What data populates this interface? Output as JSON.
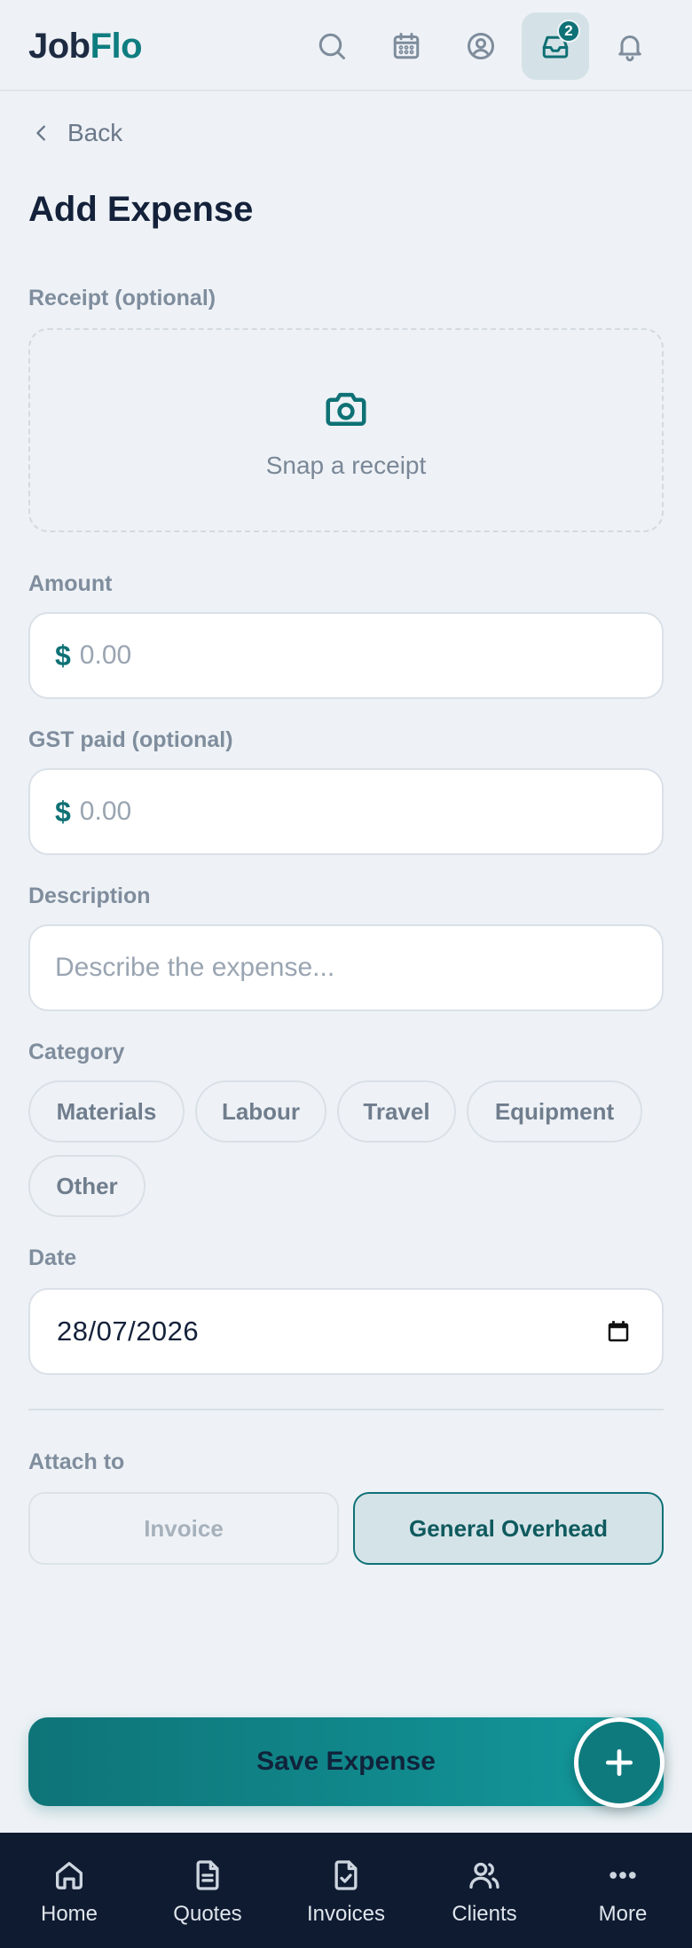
{
  "header": {
    "logo_part1": "Job",
    "logo_part2": "Flo",
    "inbox_badge": "2",
    "icons": [
      "search-icon",
      "calendar-icon",
      "user-circle-icon",
      "inbox-icon",
      "bell-icon"
    ]
  },
  "nav": {
    "back_label": "Back"
  },
  "page": {
    "title": "Add Expense"
  },
  "receipt": {
    "label": "Receipt (optional)",
    "prompt": "Snap a receipt"
  },
  "amount": {
    "label": "Amount",
    "currency": "$",
    "placeholder": "0.00",
    "value": ""
  },
  "gst": {
    "label": "GST paid (optional)",
    "currency": "$",
    "placeholder": "0.00",
    "value": ""
  },
  "description": {
    "label": "Description",
    "placeholder": "Describe the expense...",
    "value": ""
  },
  "category": {
    "label": "Category",
    "options": [
      "Materials",
      "Labour",
      "Travel",
      "Equipment",
      "Other"
    ]
  },
  "date": {
    "label": "Date",
    "value": "28/07/2026"
  },
  "attach": {
    "label": "Attach to",
    "options": [
      "Invoice",
      "General Overhead"
    ],
    "selected": "General Overhead"
  },
  "actions": {
    "save_label": "Save Expense"
  },
  "bottom_nav": [
    {
      "label": "Home",
      "icon": "home-icon"
    },
    {
      "label": "Quotes",
      "icon": "document-icon"
    },
    {
      "label": "Invoices",
      "icon": "document-check-icon"
    },
    {
      "label": "Clients",
      "icon": "users-icon"
    },
    {
      "label": "More",
      "icon": "more-icon"
    }
  ],
  "colors": {
    "accent": "#0e7175",
    "background": "#eef2f6",
    "nav_background": "#0f1b31"
  }
}
